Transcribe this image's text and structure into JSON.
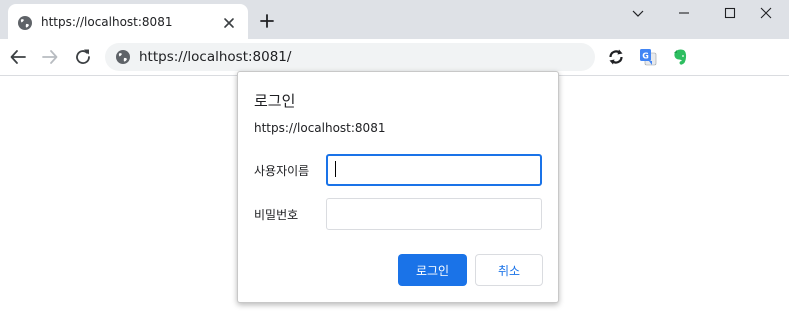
{
  "browser": {
    "tab": {
      "title": "https://localhost:8081"
    },
    "address_bar": {
      "url": "https://localhost:8081/"
    },
    "extensions": [
      "sync-icon",
      "google-translate-icon",
      "evernote-icon"
    ]
  },
  "dialog": {
    "title": "로그인",
    "origin": "https://localhost:8081",
    "username": {
      "label": "사용자이름",
      "value": ""
    },
    "password": {
      "label": "비밀번호",
      "value": ""
    },
    "login_button": "로그인",
    "cancel_button": "취소"
  },
  "colors": {
    "accent": "#1a73e8",
    "tabstrip_bg": "#dee1e6",
    "omnibox_bg": "#f1f3f4",
    "evernote_green": "#2dbe60"
  }
}
